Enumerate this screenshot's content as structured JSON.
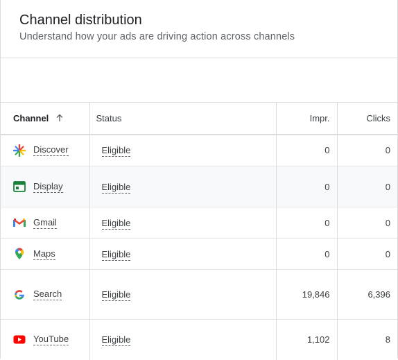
{
  "header": {
    "title": "Channel distribution",
    "subtitle": "Understand how your ads are driving action across channels"
  },
  "table": {
    "columns": {
      "channel": "Channel",
      "status": "Status",
      "impressions": "Impr.",
      "clicks": "Clicks"
    },
    "sort": {
      "column": "Channel",
      "direction": "ascending",
      "icon": "arrow-up-icon"
    },
    "rows": [
      {
        "icon": "discover-icon",
        "channel": "Discover",
        "status": "Eligible",
        "impressions": "0",
        "clicks": "0"
      },
      {
        "icon": "display-icon",
        "channel": "Display",
        "status": "Eligible",
        "impressions": "0",
        "clicks": "0"
      },
      {
        "icon": "gmail-icon",
        "channel": "Gmail",
        "status": "Eligible",
        "impressions": "0",
        "clicks": "0"
      },
      {
        "icon": "maps-icon",
        "channel": "Maps",
        "status": "Eligible",
        "impressions": "0",
        "clicks": "0"
      },
      {
        "icon": "google-search-icon",
        "channel": "Search",
        "status": "Eligible",
        "impressions": "19,846",
        "clicks": "6,396"
      },
      {
        "icon": "youtube-icon",
        "channel": "YouTube",
        "status": "Eligible",
        "impressions": "1,102",
        "clicks": "8"
      }
    ]
  }
}
